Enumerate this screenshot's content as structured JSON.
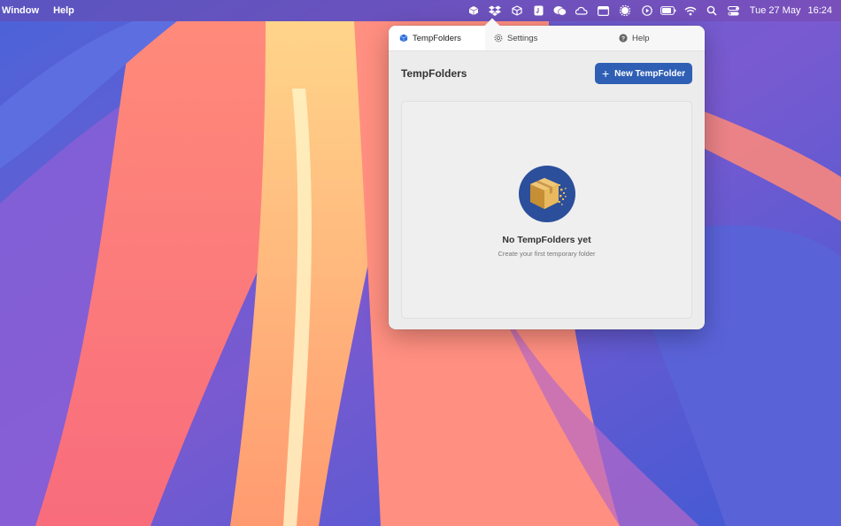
{
  "menubar": {
    "menus": [
      "Window",
      "Help"
    ],
    "status_icons": [
      "tempfolders-box-icon",
      "dropbox-icon",
      "cube-icon",
      "note-icon",
      "wechat-icon",
      "cloud-app-icon",
      "window-icon",
      "gear-badge-icon",
      "play-circle-icon",
      "battery-icon",
      "wifi-icon",
      "search-icon",
      "control-center-icon"
    ],
    "date": "Tue 27 May",
    "time": "16:24"
  },
  "popover": {
    "tabs": [
      {
        "label": "TempFolders",
        "icon": "cube-icon",
        "active": true
      },
      {
        "label": "Settings",
        "icon": "gear-icon",
        "active": false
      },
      {
        "label": "Help",
        "icon": "question-circle-icon",
        "active": false
      }
    ],
    "title": "TempFolders",
    "new_button": "New TempFolder",
    "empty_state": {
      "icon": "box-dissolve-icon",
      "title": "No TempFolders yet",
      "subtitle": "Create your first temporary folder"
    }
  },
  "colors": {
    "accent": "#2f5fb4",
    "empty_icon_bg": "#2c4f9b"
  }
}
